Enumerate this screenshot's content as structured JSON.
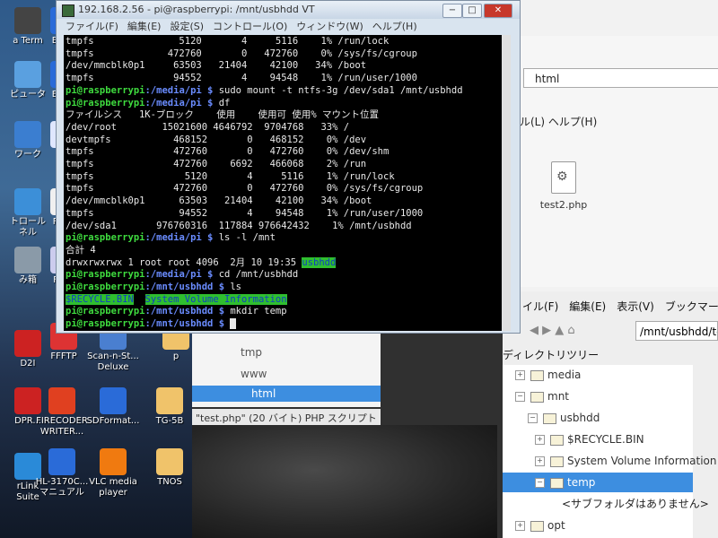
{
  "desktop": {
    "icons": [
      {
        "label": "a Term"
      },
      {
        "label": "EPSO"
      },
      {
        "label": "ピュータ"
      },
      {
        "label": "EPSO"
      },
      {
        "label": "ワーク"
      },
      {
        "label": "Fav"
      },
      {
        "label": "トロール\nネル"
      },
      {
        "label": "FavD"
      },
      {
        "label": "み箱"
      },
      {
        "label": "FavV"
      },
      {
        "label": "FFFTP"
      },
      {
        "label": "Scan-n-St...\nDeluxe"
      },
      {
        "label": "p"
      },
      {
        "label": "D2I"
      },
      {
        "label": "DPR..."
      },
      {
        "label": "FIRECODER\nWRITER..."
      },
      {
        "label": "SDFormat..."
      },
      {
        "label": "TG-5B"
      },
      {
        "label": "rLink\nSuite"
      },
      {
        "label": "HL-3170C...\nマニュアル"
      },
      {
        "label": "VLC media\nplayer"
      },
      {
        "label": "TNOS"
      }
    ]
  },
  "file_manager_top": {
    "path": "html",
    "menu": "ル(L)   ヘルプ(H)",
    "file_name": "test2.php"
  },
  "file_manager": {
    "menu": [
      "イル(F)",
      "編集(E)",
      "表示(V)",
      "ブックマーク"
    ],
    "path": "/mnt/usbhdd/te",
    "tree_title": "ディレクトリツリー",
    "tree": [
      {
        "label": "media",
        "exp": "+"
      },
      {
        "label": "mnt",
        "exp": "−"
      },
      {
        "label": "usbhdd",
        "exp": "−"
      },
      {
        "label": "$RECYCLE.BIN",
        "exp": "+"
      },
      {
        "label": "System Volume Information",
        "exp": "+"
      },
      {
        "label": "temp",
        "exp": "−"
      },
      {
        "label": "opt",
        "exp": "+"
      }
    ],
    "no_subfolder": "<サブフォルダはありません>"
  },
  "web_window": {
    "items": [
      "tmp",
      "www",
      "html"
    ],
    "status": "\"test.php\" (20 バイト) PHP スクリプト"
  },
  "terminal": {
    "title": "192.168.2.56 - pi@raspberrypi: /mnt/usbhdd VT",
    "buttons": {
      "minimize": "−",
      "maximize": "□",
      "close": "✕"
    },
    "menu": [
      "ファイル(F)",
      "編集(E)",
      "設定(S)",
      "コントロール(O)",
      "ウィンドウ(W)",
      "ヘルプ(H)"
    ],
    "lines": [
      {
        "text": "tmpfs               5120       4     5116    1% /run/lock"
      },
      {
        "text": "tmpfs             472760       0   472760    0% /sys/fs/cgroup"
      },
      {
        "text": "/dev/mmcblk0p1     63503   21404    42100   34% /boot"
      },
      {
        "text": "tmpfs              94552       4    94548    1% /run/user/1000"
      },
      {
        "prompt": "pi@raspberrypi",
        "dir": ":/media/pi $",
        "text": " sudo mount -t ntfs-3g /dev/sda1 /mnt/usbhdd"
      },
      {
        "prompt": "pi@raspberrypi",
        "dir": ":/media/pi $",
        "text": " df"
      },
      {
        "text": "ファイルシス   1K-ブロック    使用    使用可 使用% マウント位置"
      },
      {
        "text": "/dev/root        15021600 4646792  9704768   33% /"
      },
      {
        "text": "devtmpfs           468152       0   468152    0% /dev"
      },
      {
        "text": "tmpfs              472760       0   472760    0% /dev/shm"
      },
      {
        "text": "tmpfs              472760    6692   466068    2% /run"
      },
      {
        "text": "tmpfs                5120       4     5116    1% /run/lock"
      },
      {
        "text": "tmpfs              472760       0   472760    0% /sys/fs/cgroup"
      },
      {
        "text": "/dev/mmcblk0p1      63503   21404    42100   34% /boot"
      },
      {
        "text": "tmpfs               94552       4    94548    1% /run/user/1000"
      },
      {
        "text": "/dev/sda1       976760316  117884 976642432    1% /mnt/usbhdd"
      },
      {
        "prompt": "pi@raspberrypi",
        "dir": ":/media/pi $",
        "text": " ls -l /mnt"
      },
      {
        "text": "合計 4"
      },
      {
        "text": "drwxrwxrwx 1 root root 4096  2月 10 19:35 ",
        "hl": "usbhdd"
      },
      {
        "prompt": "pi@raspberrypi",
        "dir": ":/media/pi $",
        "text": " cd /mnt/usbhdd"
      },
      {
        "prompt": "pi@raspberrypi",
        "dir": ":/mnt/usbhdd $",
        "text": " ls"
      },
      {
        "hl": "$RECYCLE.BIN",
        "gap": "  ",
        "hl2": "System Volume Information"
      },
      {
        "prompt": "pi@raspberrypi",
        "dir": ":/mnt/usbhdd $",
        "text": " mkdir temp"
      },
      {
        "prompt": "pi@raspberrypi",
        "dir": ":/mnt/usbhdd $",
        "text": " ",
        "cursor": true
      }
    ]
  }
}
